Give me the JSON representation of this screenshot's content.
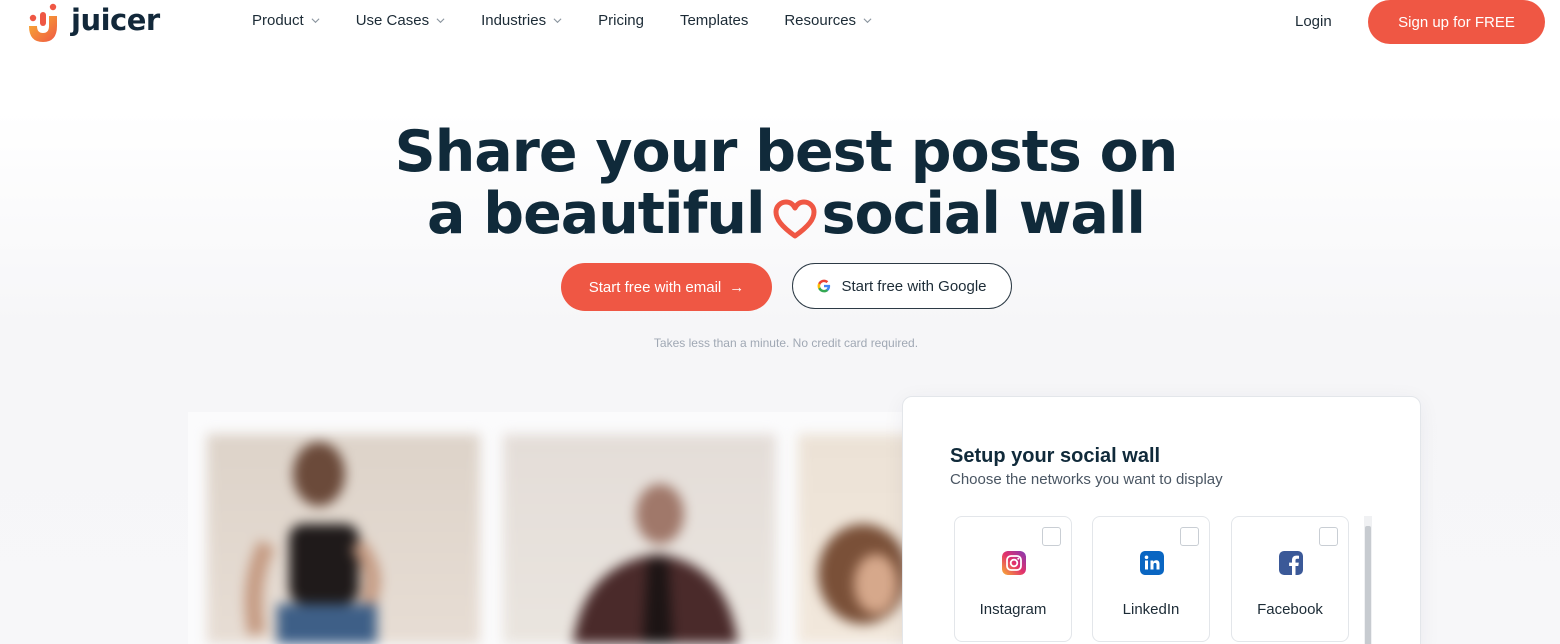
{
  "brand": {
    "name": "juicer",
    "accent": "#ef5744",
    "dark": "#102a3a"
  },
  "nav": {
    "items": [
      {
        "label": "Product",
        "dropdown": true
      },
      {
        "label": "Use Cases",
        "dropdown": true
      },
      {
        "label": "Industries",
        "dropdown": true
      },
      {
        "label": "Pricing",
        "dropdown": false
      },
      {
        "label": "Templates",
        "dropdown": false
      },
      {
        "label": "Resources",
        "dropdown": true
      }
    ],
    "login": "Login",
    "signup": "Sign up for FREE"
  },
  "hero": {
    "line1": "Share your best posts on",
    "line2_a": "a beautiful",
    "line2_b": "social wall",
    "cta_email": "Start free with email",
    "cta_email_arrow": "→",
    "cta_google": "Start free with Google",
    "note": "Takes less than a minute. No credit card required."
  },
  "setup": {
    "title": "Setup your social wall",
    "subtitle": "Choose the networks you want to display",
    "networks": [
      {
        "label": "Instagram",
        "icon": "instagram-icon",
        "checked": false
      },
      {
        "label": "LinkedIn",
        "icon": "linkedin-icon",
        "checked": false
      },
      {
        "label": "Facebook",
        "icon": "facebook-icon",
        "checked": false
      }
    ]
  }
}
